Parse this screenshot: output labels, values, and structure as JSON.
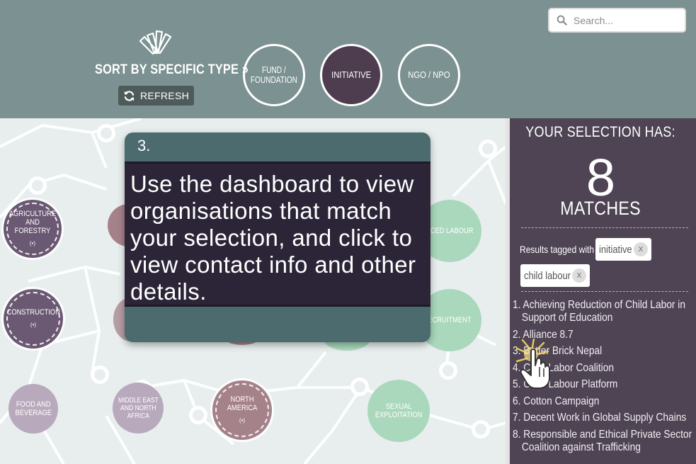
{
  "header": {
    "sort_label": "SORT BY SPECIFIC TYPE »",
    "refresh_label": "REFRESH",
    "type_buttons": [
      {
        "label_line1": "FUND /",
        "label_line2": "FOUNDATION",
        "selected": false
      },
      {
        "label_line1": "INITIATIVE",
        "label_line2": "",
        "selected": true
      },
      {
        "label_line1": "NGO / NPO",
        "label_line2": "",
        "selected": false
      }
    ],
    "search": {
      "placeholder": "Search..."
    }
  },
  "network": {
    "bubbles": [
      {
        "id": "agri",
        "line1": "AGRICULTURE",
        "line2": "AND FORESTRY",
        "count": "(•)"
      },
      {
        "id": "constr",
        "line1": "CONSTRUCTION",
        "line2": "",
        "count": "(•)"
      },
      {
        "id": "food",
        "line1": "FOOD AND",
        "line2": "BEVERAGE",
        "count": ""
      },
      {
        "id": "mideast",
        "line1": "MIDDLE EAST",
        "line2": "AND NORTH",
        "line3": "AFRICA",
        "count": ""
      },
      {
        "id": "northam",
        "line1": "NORTH AMERICA",
        "line2": "",
        "count": "(•)"
      },
      {
        "id": "sexual",
        "line1": "SEXUAL",
        "line2": "EXPLOITATION",
        "count": ""
      },
      {
        "id": "forced",
        "line1": "RCED LABOUR",
        "line2": "",
        "count": ""
      },
      {
        "id": "recruit",
        "line1": "ECRUITMENT",
        "line2": "",
        "count": ""
      }
    ]
  },
  "tooltip": {
    "step": "3.",
    "text": "Use the dashboard to view organisations that match your selection, and click to view contact info and other details."
  },
  "selection": {
    "heading": "YOUR SELECTION HAS:",
    "count": "8",
    "matches_label": "MATCHES",
    "tagged_label": "Results tagged with",
    "tags": [
      {
        "label": "initiative",
        "remove": "X"
      },
      {
        "label": "child labour",
        "remove": "X"
      }
    ],
    "results": [
      "1. Achieving Reduction of Child Labor in Support of Education",
      "2. Alliance 8.7",
      "3. Better Brick Nepal",
      "4. Child Labor Coalition",
      "5. Child Labour Platform",
      "6. Cotton Campaign",
      "7. Decent Work in Global Supply Chains",
      "8. Responsible and Ethical Private Sector Coalition against Trafficking"
    ]
  },
  "colors": {
    "header_bg": "#7c9191",
    "selected_type": "#4e3c4f",
    "panel_bg": "#4e4454",
    "tooltip_header": "#4b6b6e",
    "tooltip_body": "#2c2537",
    "bubble_purple": "#6b5873",
    "bubble_mauve": "#a5828a",
    "bubble_lilac": "#b8a9bd",
    "bubble_mint": "#a9d8bc"
  },
  "icons": {
    "fan": "swatch-fan-icon",
    "refresh": "refresh-icon",
    "search": "search-icon",
    "cursor": "hand-pointer-icon"
  }
}
